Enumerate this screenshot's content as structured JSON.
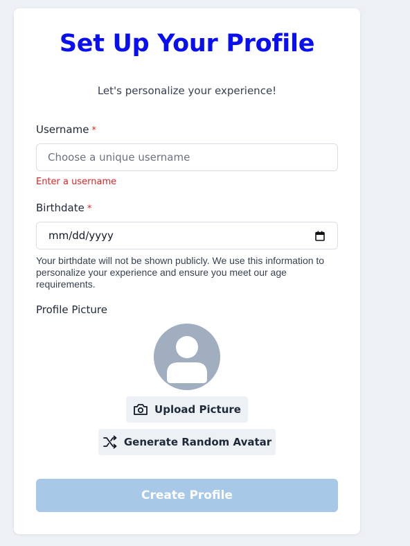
{
  "form": {
    "title": "Set Up Your Profile",
    "subtitle": "Let's personalize your experience!",
    "username": {
      "label": "Username",
      "required_mark": "*",
      "placeholder": "Choose a unique username",
      "value": "",
      "error": "Enter a username"
    },
    "birthdate": {
      "label": "Birthdate",
      "required_mark": "*",
      "value": "mm/dd/yyyy",
      "help": "Your birthdate will not be shown publicly. We use this information to personalize your experience and ensure you meet our age requirements."
    },
    "profile_picture": {
      "label": "Profile Picture",
      "upload_label": "Upload Picture",
      "random_label": "Generate Random Avatar"
    },
    "submit_label": "Create Profile"
  },
  "icons": {
    "calendar": "calendar-icon",
    "camera": "camera-icon",
    "shuffle": "shuffle-icon",
    "avatar": "user-avatar-icon"
  },
  "colors": {
    "title": "#0a0ff0",
    "error": "#dc2626",
    "primary_disabled": "#a8c8e8",
    "avatar_bg": "#a0aec0",
    "page_bg": "#edf1f5"
  }
}
